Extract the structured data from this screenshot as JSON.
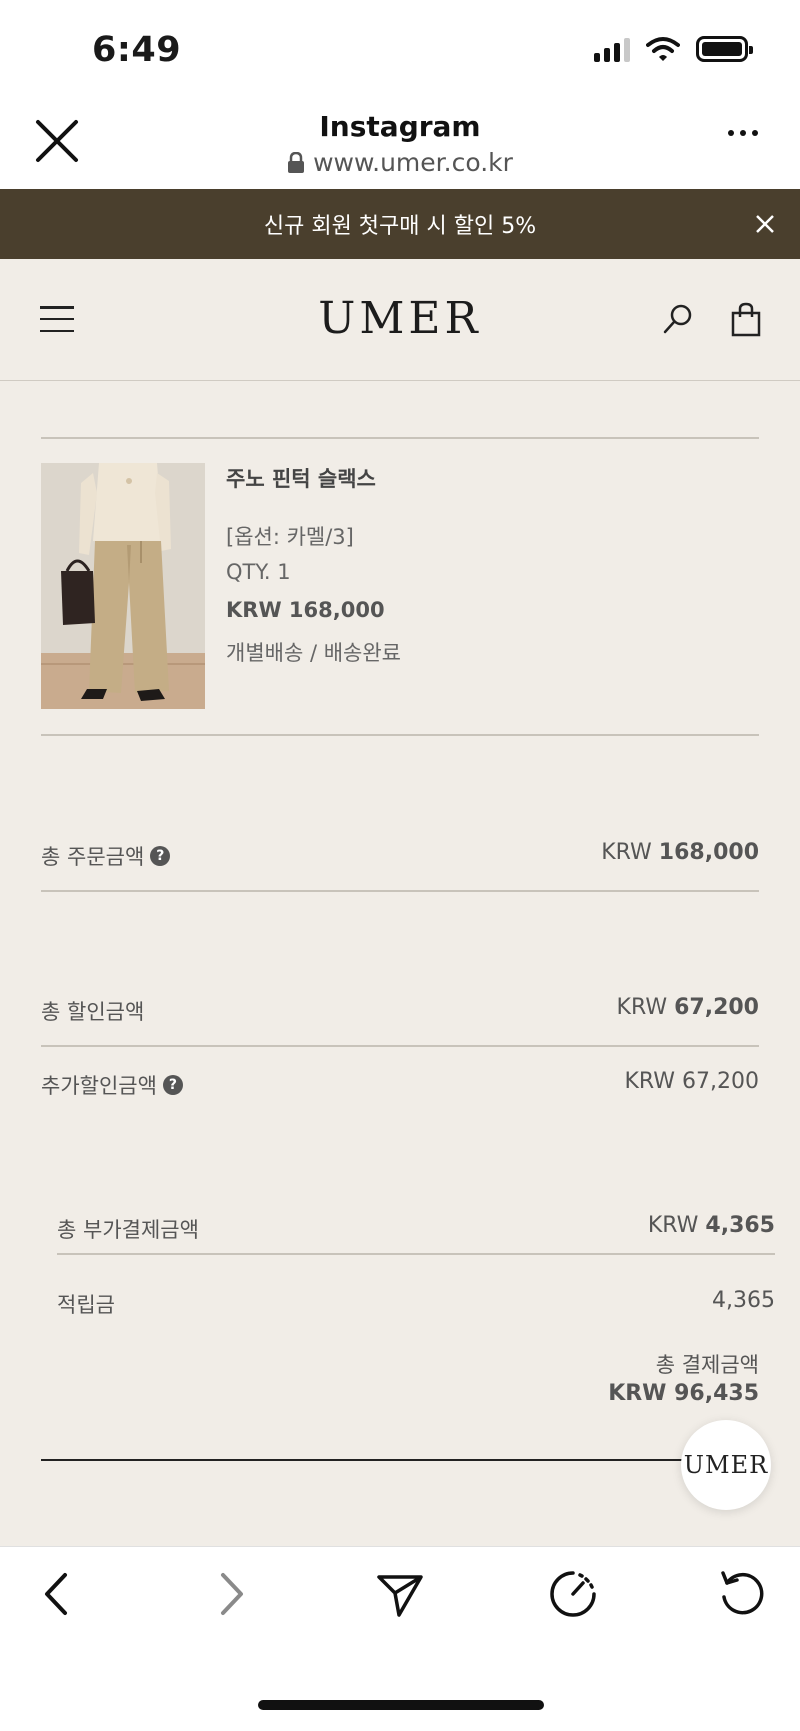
{
  "status_bar": {
    "time": "6:49"
  },
  "browser": {
    "title": "Instagram",
    "url": "www.umer.co.kr"
  },
  "promo": {
    "text": "신규 회원 첫구매 시 할인 5%"
  },
  "site": {
    "logo": "UMER"
  },
  "product": {
    "name": "주노 핀턱 슬랙스",
    "option": "[옵션: 카멜/3]",
    "qty": "QTY. 1",
    "price": "KRW 168,000",
    "shipping": "개별배송 / 배송완료"
  },
  "summary": {
    "total_order_label": "총 주문금액",
    "total_order_currency": "KRW ",
    "total_order_amount": "168,000",
    "total_discount_label": "총 할인금액",
    "total_discount_currency": "KRW ",
    "total_discount_amount": "67,200",
    "extra_discount_label": "추가할인금액",
    "extra_discount_value": "KRW 67,200",
    "total_extra_payment_label": "총 부가결제금액",
    "total_extra_payment_currency": "KRW ",
    "total_extra_payment_amount": "4,365",
    "points_label": "적립금",
    "points_value": "4,365",
    "total_payment_label": "총 결제금액",
    "total_payment_value": "KRW 96,435"
  },
  "fab": {
    "label": "UMER"
  },
  "icons": {
    "close": "close-icon",
    "lock": "lock-icon",
    "more": "more-icon",
    "menu": "hamburger-icon",
    "search": "search-icon",
    "bag": "shopping-bag-icon",
    "help": "question-circle-icon",
    "back": "chevron-left-icon",
    "forward": "chevron-right-icon",
    "share": "send-icon",
    "speed": "speedometer-icon",
    "reload": "reload-icon"
  },
  "colors": {
    "promo_bg": "#4a3f2d",
    "page_bg": "#f1ede7"
  }
}
